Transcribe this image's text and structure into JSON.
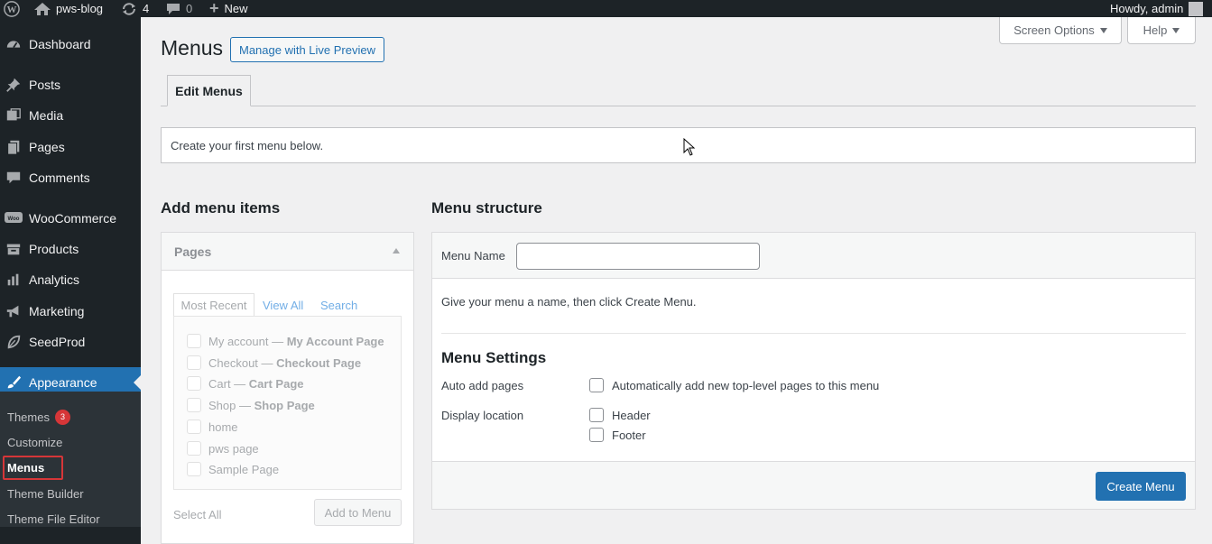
{
  "adminbar": {
    "site_name": "pws-blog",
    "updates_count": "4",
    "comments_count": "0",
    "new_label": "New",
    "howdy": "Howdy, admin"
  },
  "sidebar": {
    "items": [
      {
        "label": "Dashboard",
        "icon": "dashboard-icon"
      },
      {
        "label": "Posts",
        "icon": "pin-icon"
      },
      {
        "label": "Media",
        "icon": "media-icon"
      },
      {
        "label": "Pages",
        "icon": "pages-icon"
      },
      {
        "label": "Comments",
        "icon": "comment-icon"
      },
      {
        "label": "WooCommerce",
        "icon": "woo-icon"
      },
      {
        "label": "Products",
        "icon": "archive-icon"
      },
      {
        "label": "Analytics",
        "icon": "chart-icon"
      },
      {
        "label": "Marketing",
        "icon": "megaphone-icon"
      },
      {
        "label": "SeedProd",
        "icon": "leaf-icon"
      },
      {
        "label": "Appearance",
        "icon": "brush-icon"
      }
    ],
    "submenu": [
      {
        "label": "Themes",
        "badge": "3"
      },
      {
        "label": "Customize"
      },
      {
        "label": "Menus"
      },
      {
        "label": "Theme Builder"
      },
      {
        "label": "Theme File Editor"
      }
    ]
  },
  "top_buttons": {
    "screen_options": "Screen Options",
    "help": "Help"
  },
  "header": {
    "title": "Menus",
    "live_preview": "Manage with Live Preview",
    "tab_edit": "Edit Menus"
  },
  "notice": "Create your first menu below.",
  "add_items": {
    "title": "Add menu items",
    "box_title": "Pages",
    "tabs": [
      "Most Recent",
      "View All",
      "Search"
    ],
    "pages": [
      {
        "name": "My account",
        "sep": " — ",
        "state": "My Account Page"
      },
      {
        "name": "Checkout",
        "sep": " — ",
        "state": "Checkout Page"
      },
      {
        "name": "Cart",
        "sep": " — ",
        "state": "Cart Page"
      },
      {
        "name": "Shop",
        "sep": " — ",
        "state": "Shop Page"
      },
      {
        "name": "home",
        "sep": "",
        "state": ""
      },
      {
        "name": "pws page",
        "sep": "",
        "state": ""
      },
      {
        "name": "Sample Page",
        "sep": "",
        "state": ""
      }
    ],
    "select_all": "Select All",
    "add_button": "Add to Menu"
  },
  "structure": {
    "title": "Menu structure",
    "name_label": "Menu Name",
    "name_value": "",
    "hint": "Give your menu a name, then click Create Menu.",
    "settings_title": "Menu Settings",
    "auto_add_label": "Auto add pages",
    "auto_add_option": "Automatically add new top-level pages to this menu",
    "display_label": "Display location",
    "locations": [
      "Header",
      "Footer"
    ],
    "create_button": "Create Menu"
  },
  "colors": {
    "sidebar_bg": "#1d2327",
    "accent": "#2271b1",
    "badge": "#d63638"
  }
}
